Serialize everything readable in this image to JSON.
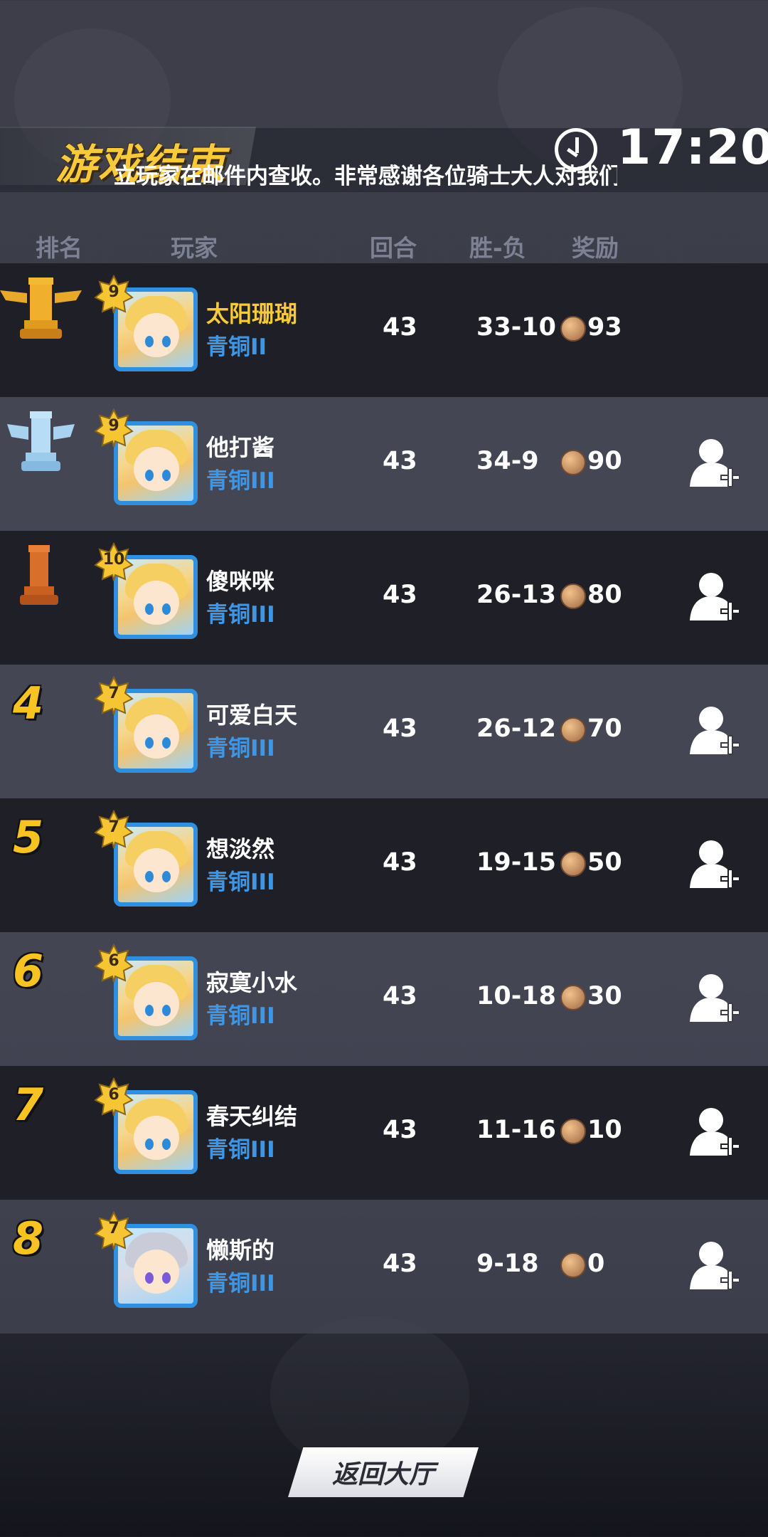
{
  "header": {
    "title": "游戏结束",
    "marquee": "立玩家在邮件内查收。非常感谢各位骑士大人对我们游戏I",
    "time": "17:20"
  },
  "columns": {
    "rank": "排名",
    "player": "玩家",
    "rounds": "回合",
    "winloss": "胜-负",
    "reward": "奖励"
  },
  "players": [
    {
      "rank": "1",
      "trophy": "gold-trophy-icon",
      "level": "9",
      "name": "太阳珊瑚",
      "tier": "青铜II",
      "rounds": "43",
      "winloss": "33-10",
      "reward": "93",
      "add_friend": false
    },
    {
      "rank": "2",
      "trophy": "silver-trophy-icon",
      "level": "9",
      "name": "他打酱",
      "tier": "青铜III",
      "rounds": "43",
      "winloss": "34-9",
      "reward": "90",
      "add_friend": true
    },
    {
      "rank": "3",
      "trophy": "bronze-trophy-icon",
      "level": "10",
      "name": "傻咪咪",
      "tier": "青铜III",
      "rounds": "43",
      "winloss": "26-13",
      "reward": "80",
      "add_friend": true
    },
    {
      "rank": "4",
      "level": "7",
      "name": "可爱白天",
      "tier": "青铜III",
      "rounds": "43",
      "winloss": "26-12",
      "reward": "70",
      "add_friend": true
    },
    {
      "rank": "5",
      "level": "7",
      "name": "想淡然",
      "tier": "青铜III",
      "rounds": "43",
      "winloss": "19-15",
      "reward": "50",
      "add_friend": true
    },
    {
      "rank": "6",
      "level": "6",
      "name": "寂寞小水",
      "tier": "青铜III",
      "rounds": "43",
      "winloss": "10-18",
      "reward": "30",
      "add_friend": true
    },
    {
      "rank": "7",
      "level": "6",
      "name": "春天纠结",
      "tier": "青铜III",
      "rounds": "43",
      "winloss": "11-16",
      "reward": "10",
      "add_friend": true
    },
    {
      "rank": "8",
      "level": "7",
      "name": "懒斯的",
      "tier": "青铜III",
      "rounds": "43",
      "winloss": "9-18",
      "reward": "0",
      "add_friend": true
    }
  ],
  "footer": {
    "return_button": "返回大厅"
  },
  "colors": {
    "gold": "#f7c93b",
    "tier_blue": "#3d97e6",
    "row_dark": "#1e1f27",
    "row_light": "#4a4b5a"
  }
}
